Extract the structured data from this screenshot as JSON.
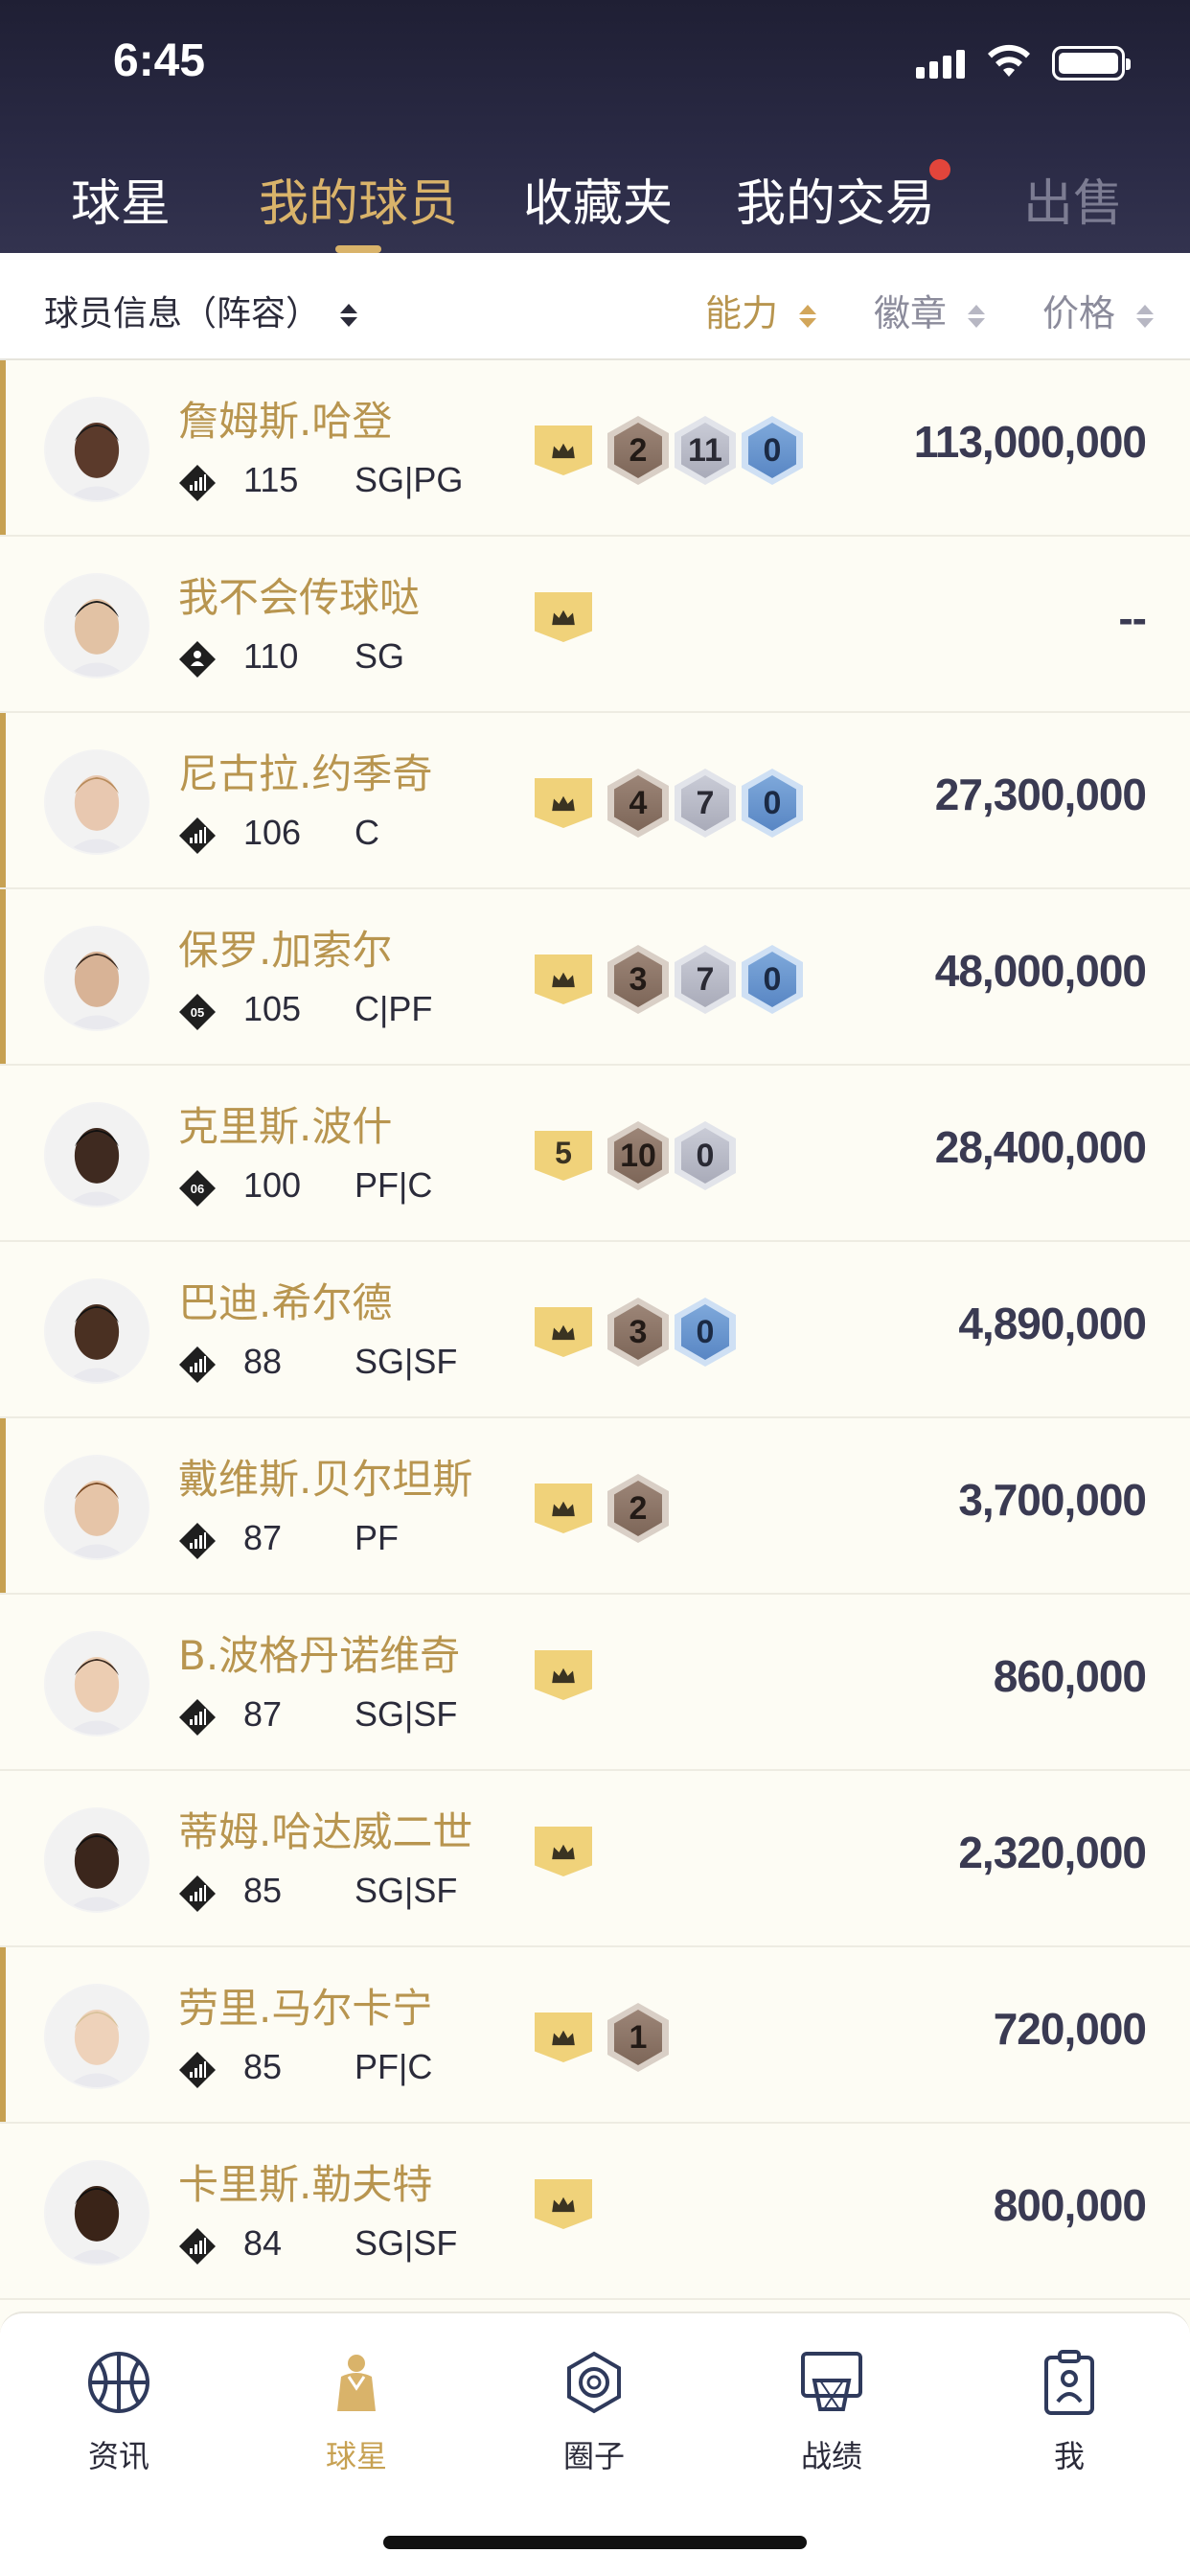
{
  "status_bar": {
    "time": "6:45"
  },
  "tabs": [
    {
      "label": "球星"
    },
    {
      "label": "我的球员"
    },
    {
      "label": "收藏夹"
    },
    {
      "label": "我的交易"
    },
    {
      "label": "出售"
    }
  ],
  "active_tab": "我的球员",
  "filter": {
    "title": "球员信息（阵容）",
    "sort": [
      {
        "label": "能力",
        "active": true
      },
      {
        "label": "徽章",
        "active": false
      },
      {
        "label": "价格",
        "active": false
      }
    ]
  },
  "players": [
    {
      "name": "詹姆斯.哈登",
      "ovr": "115",
      "pos": "SG|PG",
      "tier": "crown",
      "bronze": "2",
      "silver": "11",
      "gold": "0",
      "price": "113,000,000",
      "rank_icon": "bars-icon"
    },
    {
      "name": "我不会传球哒",
      "ovr": "110",
      "pos": "SG",
      "tier": "crown",
      "price": "--",
      "rank_icon": "person-icon"
    },
    {
      "name": "尼古拉.约季奇",
      "ovr": "106",
      "pos": "C",
      "tier": "crown",
      "bronze": "4",
      "silver": "7",
      "gold": "0",
      "price": "27,300,000",
      "rank_icon": "bars-icon"
    },
    {
      "name": "保罗.加索尔",
      "ovr": "105",
      "pos": "C|PF",
      "tier": "crown",
      "bronze": "3",
      "silver": "7",
      "gold": "0",
      "price": "48,000,000",
      "rank_icon": "05"
    },
    {
      "name": "克里斯.波什",
      "ovr": "100",
      "pos": "PF|C",
      "tier": "5",
      "bronze": "10",
      "silver": "0",
      "price": "28,400,000",
      "rank_icon": "06"
    },
    {
      "name": "巴迪.希尔德",
      "ovr": "88",
      "pos": "SG|SF",
      "tier": "crown",
      "bronze": "3",
      "gold": "0",
      "price": "4,890,000",
      "rank_icon": "bars-icon"
    },
    {
      "name": "戴维斯.贝尔坦斯",
      "ovr": "87",
      "pos": "PF",
      "tier": "crown",
      "bronze": "2",
      "price": "3,700,000",
      "rank_icon": "bars-icon"
    },
    {
      "name": "B.波格丹诺维奇",
      "ovr": "87",
      "pos": "SG|SF",
      "tier": "crown",
      "price": "860,000",
      "rank_icon": "bars-icon"
    },
    {
      "name": "蒂姆.哈达威二世",
      "ovr": "85",
      "pos": "SG|SF",
      "tier": "crown",
      "price": "2,320,000",
      "rank_icon": "bars-icon"
    },
    {
      "name": "劳里.马尔卡宁",
      "ovr": "85",
      "pos": "PF|C",
      "tier": "crown",
      "bronze": "1",
      "price": "720,000",
      "rank_icon": "bars-icon"
    },
    {
      "name": "卡里斯.勒夫特",
      "ovr": "84",
      "pos": "SG|SF",
      "tier": "crown",
      "price": "800,000",
      "rank_icon": "bars-icon"
    }
  ],
  "bottom_nav": [
    {
      "label": "资讯",
      "icon": "basketball-icon"
    },
    {
      "label": "球星",
      "icon": "player-jersey-icon"
    },
    {
      "label": "圈子",
      "icon": "circle-hex-icon"
    },
    {
      "label": "战绩",
      "icon": "hoop-icon"
    },
    {
      "label": "我",
      "icon": "clipboard-user-icon"
    }
  ],
  "colors": {
    "accent_gold": "#c7a152",
    "header_bg": "#24243c",
    "notification_dot": "#e2453b"
  }
}
